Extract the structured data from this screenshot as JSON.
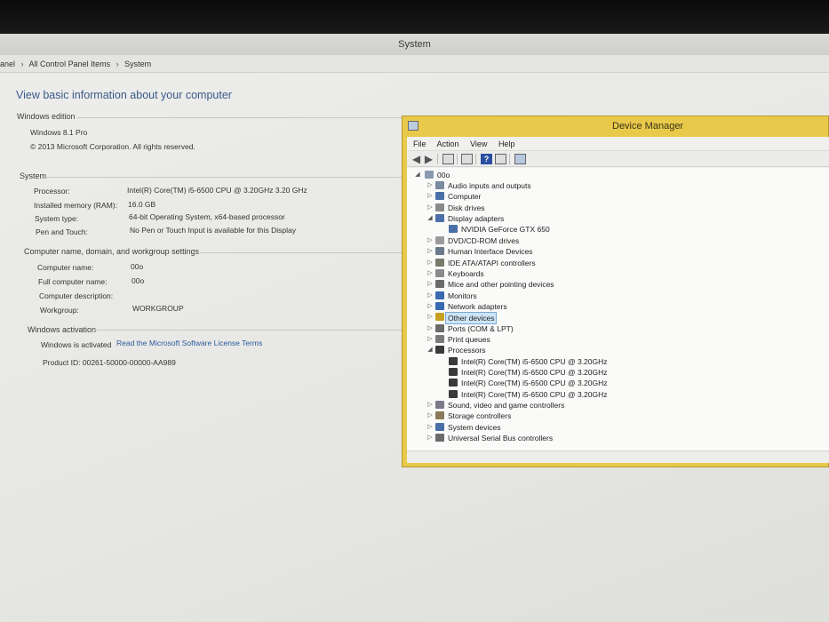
{
  "system_window": {
    "title": "System",
    "breadcrumb": [
      "anel",
      "All Control Panel Items",
      "System"
    ],
    "heading": "View basic information about your computer",
    "windows_edition": {
      "title": "Windows edition",
      "edition": "Windows 8.1 Pro",
      "copyright": "© 2013 Microsoft Corporation. All rights reserved."
    },
    "system": {
      "title": "System",
      "rows": [
        {
          "label": "Processor:",
          "value": "Intel(R) Core(TM) i5-6500 CPU @ 3.20GHz   3.20 GHz"
        },
        {
          "label": "Installed memory (RAM):",
          "value": "16.0 GB"
        },
        {
          "label": "System type:",
          "value": "64-bit Operating System, x64-based processor"
        },
        {
          "label": "Pen and Touch:",
          "value": "No Pen or Touch Input is available for this Display"
        }
      ]
    },
    "computer_name": {
      "title": "Computer name, domain, and workgroup settings",
      "rows": [
        {
          "label": "Computer name:",
          "value": "00o"
        },
        {
          "label": "Full computer name:",
          "value": "00o"
        },
        {
          "label": "Computer description:",
          "value": ""
        },
        {
          "label": "Workgroup:",
          "value": "WORKGROUP"
        }
      ]
    },
    "activation": {
      "title": "Windows activation",
      "status": "Windows is activated",
      "link": "Read the Microsoft Software License Terms",
      "product_id": "Product ID: 00261-50000-00000-AA989"
    }
  },
  "device_manager": {
    "title": "Device Manager",
    "menu": [
      "File",
      "Action",
      "View",
      "Help"
    ],
    "toolbar_icons": [
      "back-arrow-icon",
      "forward-arrow-icon",
      "properties-icon",
      "update-icon",
      "help-icon",
      "show-hidden-icon",
      "scan-hardware-icon"
    ],
    "root": "00o",
    "tree": [
      {
        "label": "Audio inputs and outputs",
        "level": 1,
        "expander": "▷",
        "color": "#7a8aa0"
      },
      {
        "label": "Computer",
        "level": 1,
        "expander": "▷",
        "color": "#4a6fa8"
      },
      {
        "label": "Disk drives",
        "level": 1,
        "expander": "▷",
        "color": "#8a8a8a"
      },
      {
        "label": "Display adapters",
        "level": 1,
        "expander": "◢",
        "color": "#4a6fa8"
      },
      {
        "label": "NVIDIA GeForce GTX 650",
        "level": 2,
        "expander": "",
        "color": "#4a6fa8"
      },
      {
        "label": "DVD/CD-ROM drives",
        "level": 1,
        "expander": "▷",
        "color": "#9a9a9a"
      },
      {
        "label": "Human Interface Devices",
        "level": 1,
        "expander": "▷",
        "color": "#6a7a8a"
      },
      {
        "label": "IDE ATA/ATAPI controllers",
        "level": 1,
        "expander": "▷",
        "color": "#7a7a6a"
      },
      {
        "label": "Keyboards",
        "level": 1,
        "expander": "▷",
        "color": "#8a8a8a"
      },
      {
        "label": "Mice and other pointing devices",
        "level": 1,
        "expander": "▷",
        "color": "#6a6a6a"
      },
      {
        "label": "Monitors",
        "level": 1,
        "expander": "▷",
        "color": "#3a6ab0"
      },
      {
        "label": "Network adapters",
        "level": 1,
        "expander": "▷",
        "color": "#3a6ab0"
      },
      {
        "label": "Other devices",
        "level": 1,
        "expander": "▷",
        "color": "#c8a020",
        "selected": true
      },
      {
        "label": "Ports (COM & LPT)",
        "level": 1,
        "expander": "▷",
        "color": "#6a6a6a"
      },
      {
        "label": "Print queues",
        "level": 1,
        "expander": "▷",
        "color": "#7a7a7a"
      },
      {
        "label": "Processors",
        "level": 1,
        "expander": "◢",
        "color": "#3a3a3a"
      },
      {
        "label": "Intel(R) Core(TM) i5-6500 CPU @ 3.20GHz",
        "level": 2,
        "expander": "",
        "color": "#3a3a3a"
      },
      {
        "label": "Intel(R) Core(TM) i5-6500 CPU @ 3.20GHz",
        "level": 2,
        "expander": "",
        "color": "#3a3a3a"
      },
      {
        "label": "Intel(R) Core(TM) i5-6500 CPU @ 3.20GHz",
        "level": 2,
        "expander": "",
        "color": "#3a3a3a"
      },
      {
        "label": "Intel(R) Core(TM) i5-6500 CPU @ 3.20GHz",
        "level": 2,
        "expander": "",
        "color": "#3a3a3a"
      },
      {
        "label": "Sound, video and game controllers",
        "level": 1,
        "expander": "▷",
        "color": "#7a7a8a"
      },
      {
        "label": "Storage controllers",
        "level": 1,
        "expander": "▷",
        "color": "#8a7a5a"
      },
      {
        "label": "System devices",
        "level": 1,
        "expander": "▷",
        "color": "#4a6fa8"
      },
      {
        "label": "Universal Serial Bus controllers",
        "level": 1,
        "expander": "▷",
        "color": "#6a6a6a"
      }
    ]
  }
}
